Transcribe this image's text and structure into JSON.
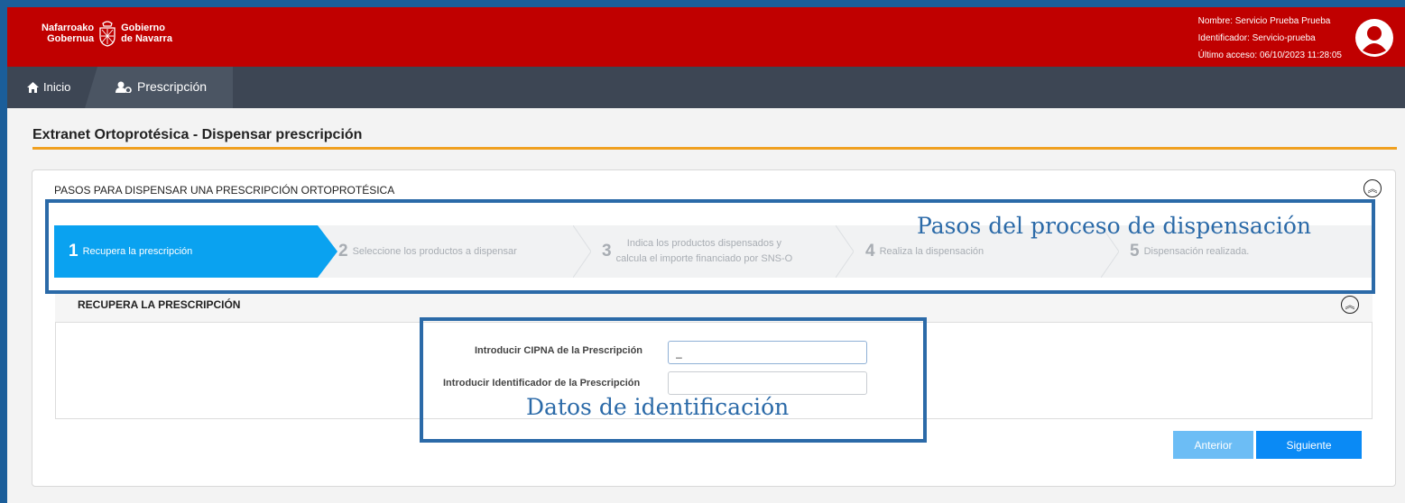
{
  "header": {
    "logo_line1_left": "Nafarroako",
    "logo_line2_left": "Gobernua",
    "logo_line1_right": "Gobierno",
    "logo_line2_right": "de Navarra",
    "user_name": "Nombre: Servicio Prueba Prueba",
    "user_id": "Identificador: Servicio-prueba",
    "last_access": "Último acceso: 06/10/2023 11:28:05",
    "brand_color": "#c00000"
  },
  "nav": {
    "home_label": "Inicio",
    "prescription_label": "Prescripción"
  },
  "page": {
    "title": "Extranet Ortoprotésica - Dispensar prescripción",
    "panel_title": "PASOS PARA DISPENSAR UNA PRESCRIPCIÓN ORTOPROTÉSICA"
  },
  "steps": [
    {
      "num": "1",
      "label": "Recupera la prescripción",
      "active": true
    },
    {
      "num": "2",
      "label": "Seleccione los productos a dispensar",
      "active": false
    },
    {
      "num": "3",
      "label_line1": "Indica los productos dispensados y",
      "label_line2": "calcula el importe financiado por SNS-O",
      "active": false
    },
    {
      "num": "4",
      "label": "Realiza la dispensación",
      "active": false
    },
    {
      "num": "5",
      "label": "Dispensación realizada.",
      "active": false
    }
  ],
  "form": {
    "section_title": "RECUPERA LA PRESCRIPCIÓN",
    "cipna_label": "Introducir CIPNA de la Prescripción",
    "cipna_value": "_",
    "id_label": "Introducir Identificador de la Prescripción",
    "id_value": ""
  },
  "buttons": {
    "prev": "Anterior",
    "next": "Siguiente"
  },
  "annotations": {
    "steps_note": "Pasos del proceso de dispensación",
    "form_note": "Datos de identificación"
  }
}
